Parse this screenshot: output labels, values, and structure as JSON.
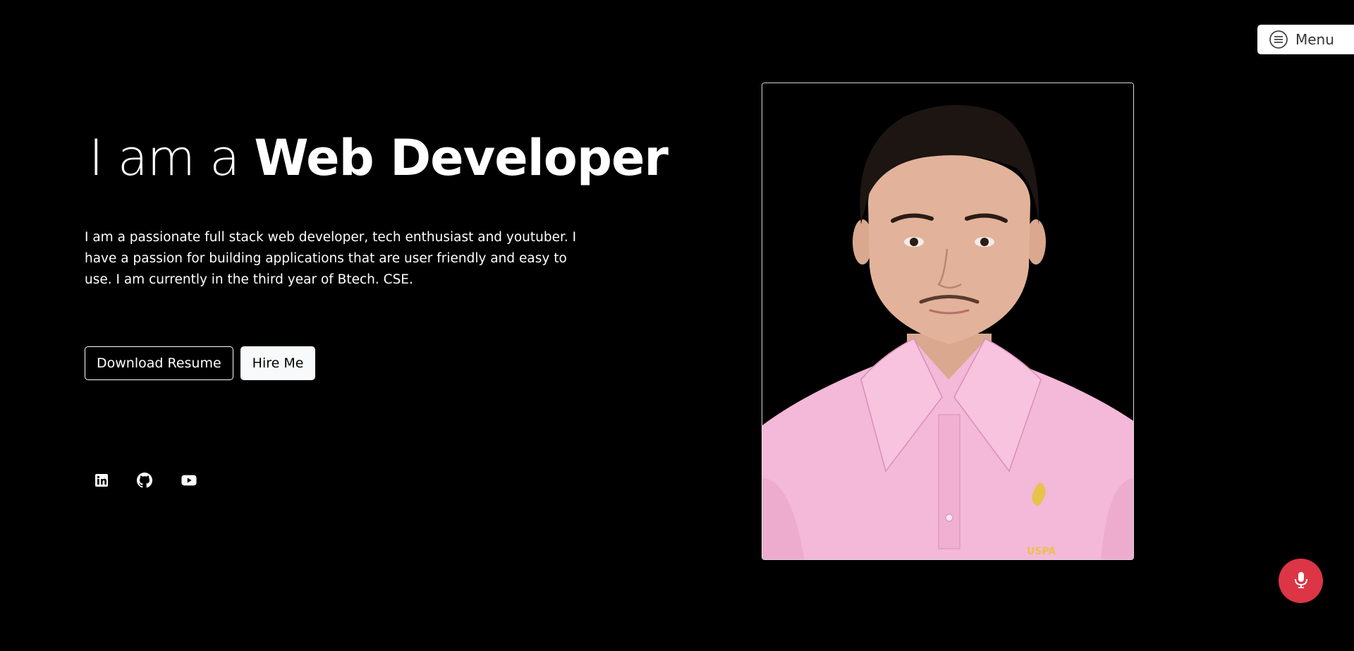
{
  "menu": {
    "label": "Menu",
    "icon": "hamburger-circle-icon"
  },
  "hero": {
    "headline_prefix": "I am a",
    "headline_bold": "Web Developer",
    "description": "I am a passionate full stack web developer, tech enthusiast and youtuber. I have a passion for building applications that are user friendly and easy to use. I am currently in the third year of Btech. CSE.",
    "buttons": {
      "download_resume": "Download Resume",
      "hire_me": "Hire Me"
    },
    "socials": [
      {
        "name": "linkedin",
        "icon": "linkedin-icon"
      },
      {
        "name": "github",
        "icon": "github-icon"
      },
      {
        "name": "youtube",
        "icon": "youtube-icon"
      }
    ]
  },
  "profile_photo": {
    "logo_text": "USPA"
  },
  "mic": {
    "icon": "microphone-icon"
  },
  "colors": {
    "background": "#000000",
    "text": "#ffffff",
    "mic_button": "#dc3545",
    "shirt": "#f4b8d8",
    "menu_bg": "#ffffff"
  }
}
